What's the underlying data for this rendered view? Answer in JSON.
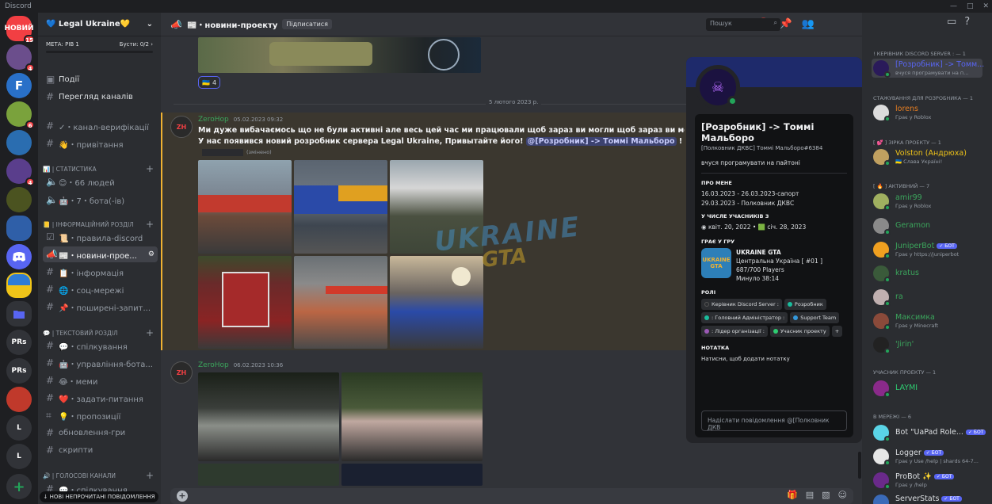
{
  "app": {
    "title": "Discord",
    "window_controls": [
      "—",
      "□",
      "✕"
    ]
  },
  "servers": [
    {
      "label": "НОВИЙ",
      "color": "#f23f43",
      "badge": "15"
    },
    {
      "label": "",
      "color": "#6b4e8c",
      "badge": "4"
    },
    {
      "label": "F",
      "color": "#2970c8",
      "badge": ""
    },
    {
      "label": "",
      "color": "#7aa23c",
      "badge": "6"
    },
    {
      "label": "",
      "color": "#2a6db0",
      "badge": ""
    },
    {
      "label": "",
      "color": "#5a3e8c",
      "badge": "4"
    },
    {
      "label": "",
      "color": "#4b5320",
      "badge": ""
    },
    {
      "label": "",
      "color": "#2f5fa8",
      "badge": ""
    },
    {
      "label": "",
      "color": "#5865f2",
      "badge": ""
    },
    {
      "label": "",
      "color": "#f0c419",
      "badge": ""
    },
    {
      "label": "",
      "color": "#5865f2",
      "badge": ""
    },
    {
      "label": "PRs",
      "color": "#313338",
      "badge": ""
    },
    {
      "label": "PRs",
      "color": "#313338",
      "badge": ""
    },
    {
      "label": "",
      "color": "#c0392b",
      "badge": ""
    },
    {
      "label": "L",
      "color": "#313338",
      "badge": ""
    },
    {
      "label": "L",
      "color": "#313338",
      "badge": ""
    },
    {
      "label": "+",
      "color": "#313338",
      "badge": ""
    }
  ],
  "guild": {
    "name": "💙 Legal Ukraine💛",
    "meta_label": "МЕТА: РІВ 1",
    "boosts": "Бусти: 0/2 ›"
  },
  "channels": {
    "events": "Події",
    "browse": "Перегляд каналів",
    "verify": "✓・канал-верифікації",
    "welcome": "👋・привітання",
    "cat_stats": "📊 | СТАТИСТИКА",
    "people": "😊・66 людей",
    "bots": "🤖・7・бота(-ів)",
    "cat_info": "📒 | ІНФОРМАЦІЙНИЙ РОЗДІЛ",
    "rules": "📜・правила-discord",
    "news": "📰・новини-прое...",
    "information": "📋・інформація",
    "social": "🌐・соц-мережі",
    "faq": "📌・поширені-запит...",
    "cat_text": "💬 | ТЕКСТОВИЙ РОЗДІЛ",
    "chat": "💬・спілкування",
    "bot_control": "🤖・управління-бота...",
    "memes": "😂・меми",
    "ask": "❤️・задати-питання",
    "suggest": "💡・пропозиції",
    "updates": "обновлення-гри",
    "scripts": "скрипти",
    "cat_voice": "🔊 | ГОЛОСОВІ КАНАЛИ",
    "voice_chat": "💬・спілкування",
    "unread": "↓ НОВІ НЕПРОЧИТАНІ ПОВІДОМЛЕННЯ"
  },
  "header": {
    "channel": "📰・новини-проекту",
    "follow": "Підписатися",
    "search_placeholder": "Пошук"
  },
  "chat": {
    "reaction": {
      "emoji": "🇺🇦",
      "count": "4"
    },
    "date_divider": "5 лютого 2023 р.",
    "msg1": {
      "author": "ZeroHop",
      "time": "05.02.2023 09:32",
      "line1": "Ми дуже вибачаємось що не були активні але весь цей час ми працювали щоб зараз ви могли щоб зараз ви могли подивитись",
      "line2_prefix": "У нас появився новий розробник сервера Legal Ukraine, Привытайте його! ",
      "mention": "@[Розробник] -> Томмі Мальборо",
      "line2_suffix": " !",
      "edited": "(змінено)"
    },
    "msg2": {
      "author": "ZeroHop",
      "time": "06.02.2023 10:36"
    },
    "watermark_top": "UKRAINE",
    "watermark_bottom": "GTA"
  },
  "profile": {
    "display_name": "[Розробник] -> Томмі Мальборо",
    "tag": "[Полковник ДКВС] Томмі Мальборо#6384",
    "note": "вчуся програмувати на пайтоні",
    "about_head": "ПРО МЕНЕ",
    "about_lines": [
      "16.03.2023 - 26.03.2023-сапорт",
      "29.03.2023 - Полковник ДКВС"
    ],
    "member_head": "У ЧИСЛЕ УЧАСНИКІВ З",
    "member_since": "квіт. 20, 2022 • 🟩 січ. 28, 2023",
    "game_head": "ГРАЄ У ГРУ",
    "game_icon": "UKRAINE GTA",
    "game_name": "UKRAINE GTA",
    "game_lines": [
      "Центральна Україна [ #01 ]",
      "687/700 Players",
      "Минуло 38:14"
    ],
    "roles_head": "РОЛІ",
    "roles": [
      {
        "name": "Керівник Discord Server :",
        "color": "#2b2d31"
      },
      {
        "name": "Розробник",
        "color": "#1abc9c"
      },
      {
        "name": ": Головний Адміністратор :",
        "color": "#1abc9c"
      },
      {
        "name": "Support Team",
        "color": "#3498db"
      },
      {
        "name": ": Лідер організації :",
        "color": "#9b59b6"
      },
      {
        "name": "Учасник проекту",
        "color": "#2ecc71"
      },
      {
        "name": "+",
        "color": ""
      }
    ],
    "notes_head": "НОТАТКА",
    "notes_placeholder": "Натисни, щоб додати нотатку",
    "message_placeholder": "Надіслати повідомлення @[Полковник ДКВ"
  },
  "members": {
    "cat1": "! КЕРІВНИК DISCORD SERVER : — 1",
    "m1": {
      "name": "[Розробник] -> Томм...",
      "status": "вчуся програмувати на п..."
    },
    "cat2": "СТАЖУВАННЯ ДЛЯ РОЗРОБНИКА — 1",
    "m2": {
      "name": "lorens",
      "status": "Грає у Roblox"
    },
    "cat3": "[ 💕 ] ЗІРКА ПРОЕКТУ — 1",
    "m3": {
      "name": "Volston (Андрюха)",
      "status": "🇺🇦 Слава Україні!"
    },
    "cat4": "[ 🔥 ] АКТИВНИЙ — 7",
    "m4": {
      "name": "amir99",
      "status": "Грає у Roblox"
    },
    "m5": {
      "name": "Geramon",
      "status": ""
    },
    "m6": {
      "name": "JuniperBot",
      "bot": "✓ БОТ",
      "status": "Грає у https://juniperbot"
    },
    "m7": {
      "name": "kratus",
      "status": ""
    },
    "m8": {
      "name": "ra",
      "status": ""
    },
    "m9": {
      "name": "Максимка",
      "status": "Грає у Minecraft"
    },
    "m10": {
      "name": "'Jirin'",
      "status": ""
    },
    "cat5": "УЧАСНИК ПРОЕКТУ — 1",
    "m11": {
      "name": "LAYMI",
      "status": ""
    },
    "cat6": "В МЕРЕЖІ — 6",
    "m12": {
      "name": "Bot \"UaPad Role...",
      "bot": "✓ БОТ",
      "status": ""
    },
    "m13": {
      "name": "Logger",
      "bot": "✓ БОТ",
      "status": "Грає у Use /help | shards 64-7..."
    },
    "m14": {
      "name": "ProBot ✨",
      "bot": "✓ БОТ",
      "status": "Грає у /help"
    },
    "m15": {
      "name": "ServerStats",
      "bot": "✓ БОТ",
      "status": ""
    }
  }
}
